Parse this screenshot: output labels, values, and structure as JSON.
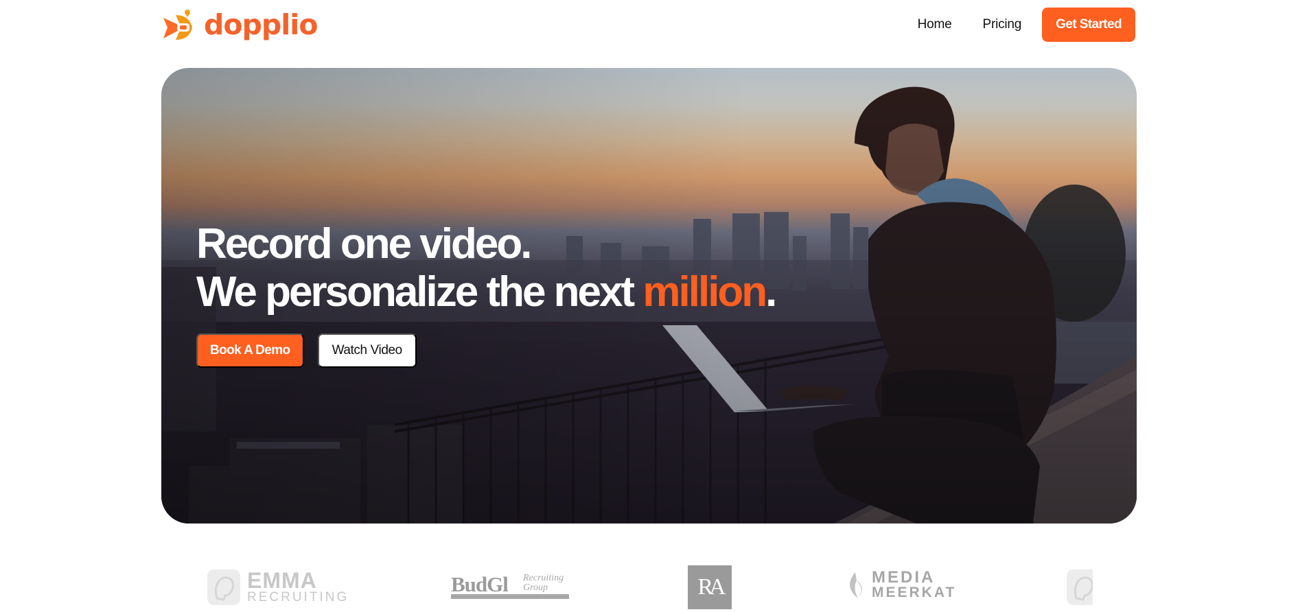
{
  "header": {
    "brand_name": "dopplio",
    "nav": [
      {
        "label": "Home"
      },
      {
        "label": "Pricing"
      }
    ],
    "cta_label": "Get Started"
  },
  "hero": {
    "headline_line1": "Record one video.",
    "headline_line2_prefix": "We personalize the next ",
    "headline_line2_accent": "million",
    "headline_line2_suffix": ".",
    "primary_button": "Book A Demo",
    "secondary_button": "Watch Video"
  },
  "clients": {
    "emma": {
      "line1": "EMMA",
      "line2": "RECRUITING"
    },
    "budget": {
      "word": "BudGl",
      "sub_line1": "Recruiting",
      "sub_line2": "Group"
    },
    "ra": {
      "monogram": "RA"
    },
    "media": {
      "line1": "MEDIA",
      "line2": "MEERKAT"
    }
  },
  "colors": {
    "accent": "#ff5f1f",
    "logo_gray": "#c7c7c7",
    "background": "#ffffff"
  },
  "icons": {
    "brand_logo": "play-arrow-logo-icon"
  }
}
